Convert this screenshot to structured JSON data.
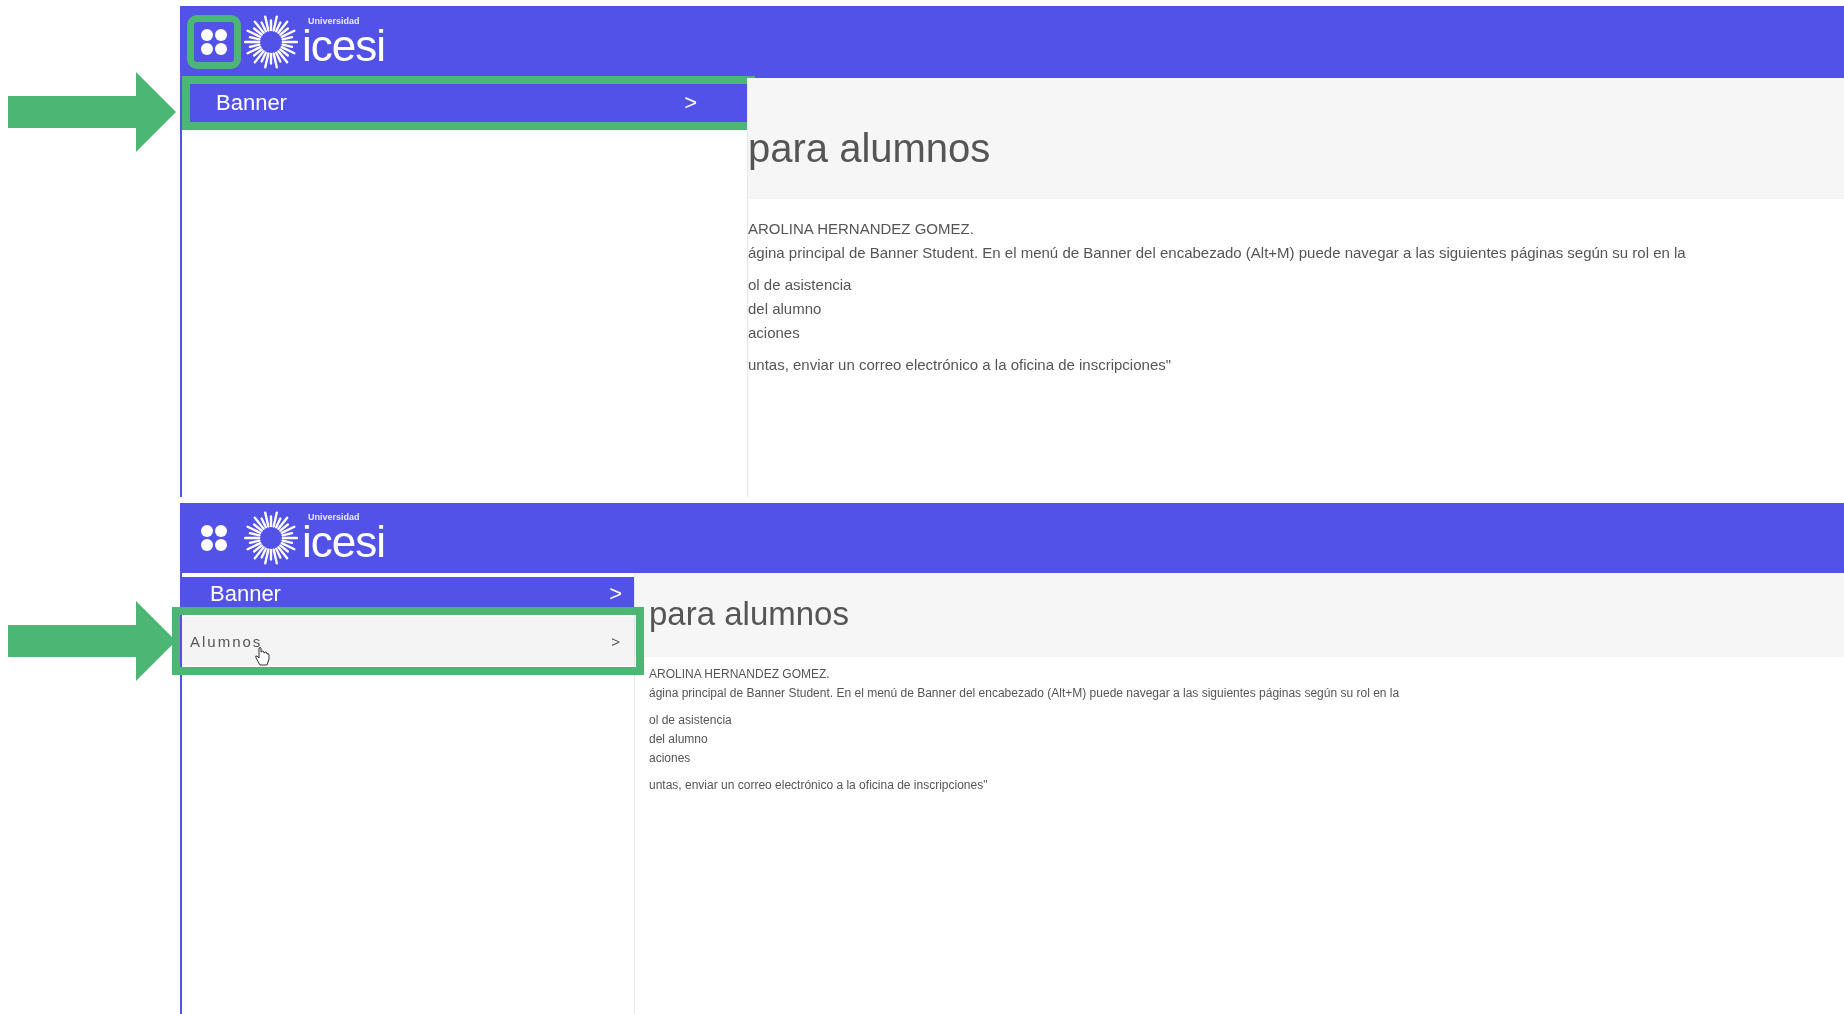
{
  "panels": [
    {
      "header": {
        "apps_highlighted": true,
        "logo_caption": "Universidad",
        "logo_text": "icesi"
      },
      "menu": [
        {
          "kind": "section",
          "label": "Banner",
          "chevron": ">",
          "highlighted": true
        }
      ],
      "content": {
        "title": "para alumnos",
        "paragraphs": [
          [
            "AROLINA HERNANDEZ GOMEZ.",
            "ágina principal de Banner Student. En el menú de Banner del encabezado (Alt+M) puede navegar a las siguientes páginas según su rol en la"
          ],
          [
            "ol de asistencia",
            "del alumno",
            "aciones"
          ],
          [
            "untas, enviar un correo electrónico a la oficina de inscripciones\""
          ]
        ]
      }
    },
    {
      "header": {
        "apps_highlighted": false,
        "logo_caption": "Universidad",
        "logo_text": "icesi"
      },
      "menu": [
        {
          "kind": "section",
          "label": "Banner",
          "chevron": ">",
          "highlighted": false
        },
        {
          "kind": "item",
          "label": "Alumnos",
          "chevron": ">",
          "highlighted": true,
          "pointer": true
        }
      ],
      "content": {
        "title": "para alumnos",
        "paragraphs": [
          [
            "AROLINA HERNANDEZ GOMEZ.",
            "ágina principal de Banner Student. En el menú de Banner del encabezado (Alt+M) puede navegar a las siguientes páginas según su rol en la"
          ],
          [
            "ol de asistencia",
            "del alumno",
            "aciones"
          ],
          [
            "untas, enviar un correo electrónico a la oficina de inscripciones\""
          ]
        ]
      }
    }
  ]
}
